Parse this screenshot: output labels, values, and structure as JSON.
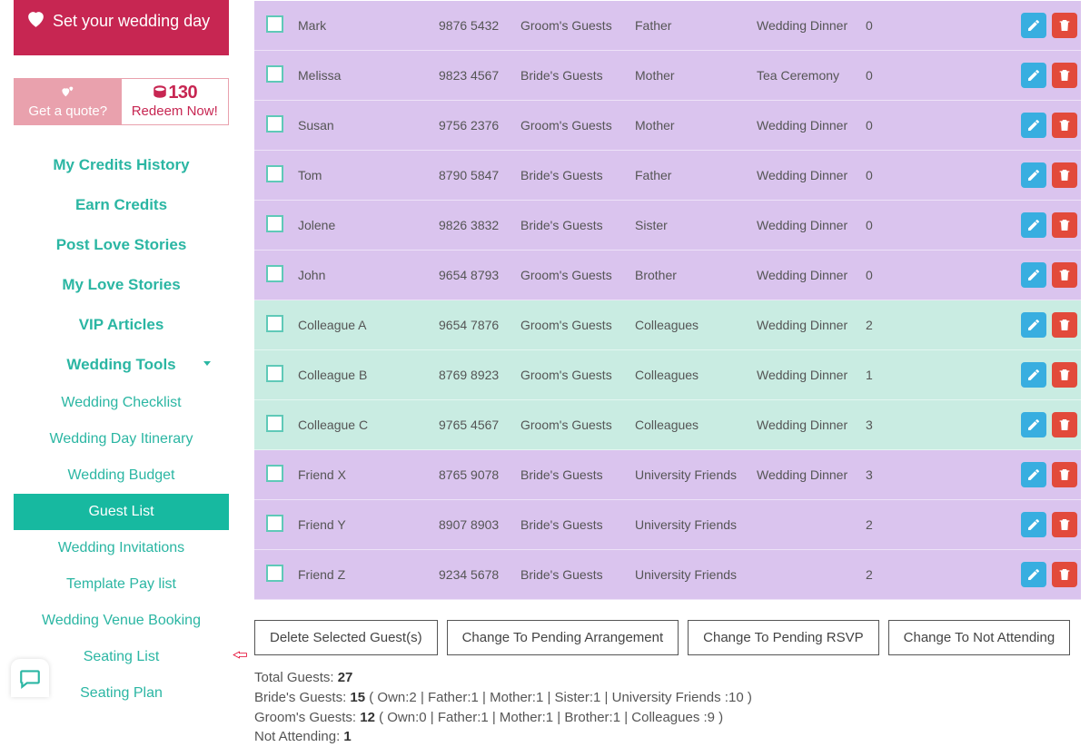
{
  "sidebar": {
    "set_day_label": "Set your wedding day",
    "quote_label": "Get a quote?",
    "credits_amount": "130",
    "redeem_label": "Redeem Now!",
    "nav_primary": [
      "My Credits History",
      "Earn Credits",
      "Post Love Stories",
      "My Love Stories",
      "VIP Articles",
      "Wedding Tools"
    ],
    "nav_sub": [
      "Wedding Checklist",
      "Wedding Day Itinerary",
      "Wedding Budget",
      "Guest List",
      "Wedding Invitations",
      "Template Pay list",
      "Wedding Venue Booking",
      "Seating List",
      "Seating Plan"
    ],
    "active_sub_index": 3,
    "arrow_sub_index": 7
  },
  "guests": [
    {
      "name": "Mark",
      "phone": "9876 5432",
      "group": "Groom's Guests",
      "relation": "Father",
      "event": "Wedding Dinner",
      "table": "0",
      "tone": "purple"
    },
    {
      "name": "Melissa",
      "phone": "9823 4567",
      "group": "Bride's Guests",
      "relation": "Mother",
      "event": "Tea Ceremony",
      "table": "0",
      "tone": "purple"
    },
    {
      "name": "Susan",
      "phone": "9756 2376",
      "group": "Groom's Guests",
      "relation": "Mother",
      "event": "Wedding Dinner",
      "table": "0",
      "tone": "purple"
    },
    {
      "name": "Tom",
      "phone": "8790 5847",
      "group": "Bride's Guests",
      "relation": "Father",
      "event": "Wedding Dinner",
      "table": "0",
      "tone": "purple"
    },
    {
      "name": "Jolene",
      "phone": "9826 3832",
      "group": "Bride's Guests",
      "relation": "Sister",
      "event": "Wedding Dinner",
      "table": "0",
      "tone": "purple"
    },
    {
      "name": "John",
      "phone": "9654 8793",
      "group": "Groom's Guests",
      "relation": "Brother",
      "event": "Wedding Dinner",
      "table": "0",
      "tone": "purple"
    },
    {
      "name": "Colleague A",
      "phone": "9654 7876",
      "group": "Groom's Guests",
      "relation": "Colleagues",
      "event": "Wedding Dinner",
      "table": "2",
      "tone": "teal"
    },
    {
      "name": "Colleague B",
      "phone": "8769 8923",
      "group": "Groom's Guests",
      "relation": "Colleagues",
      "event": "Wedding Dinner",
      "table": "1",
      "tone": "teal"
    },
    {
      "name": "Colleague C",
      "phone": "9765 4567",
      "group": "Groom's Guests",
      "relation": "Colleagues",
      "event": "Wedding Dinner",
      "table": "3",
      "tone": "teal"
    },
    {
      "name": "Friend X",
      "phone": "8765 9078",
      "group": "Bride's Guests",
      "relation": "University Friends",
      "event": "Wedding Dinner",
      "table": "3",
      "tone": "purple"
    },
    {
      "name": "Friend Y",
      "phone": "8907 8903",
      "group": "Bride's Guests",
      "relation": "University Friends",
      "event": "",
      "table": "2",
      "tone": "purple"
    },
    {
      "name": "Friend Z",
      "phone": "9234 5678",
      "group": "Bride's Guests",
      "relation": "University Friends",
      "event": "",
      "table": "2",
      "tone": "purple"
    }
  ],
  "bulk": {
    "delete": "Delete Selected Guest(s)",
    "pending_arr": "Change To Pending Arrangement",
    "pending_rsvp": "Change To Pending RSVP",
    "not_attending": "Change To Not Attending"
  },
  "stats": {
    "total_label": "Total Guests: ",
    "total_val": "27",
    "bride_line": "Bride's Guests: ",
    "bride_val": "15",
    "bride_detail": " ( Own:2 | Father:1 | Mother:1 | Sister:1 | University Friends :10 )",
    "groom_line": "Groom's Guests: ",
    "groom_val": "12",
    "groom_detail": " ( Own:0 | Father:1 | Mother:1 | Brother:1 | Colleagues :9 )",
    "na_label": "Not Attending: ",
    "na_val": "1"
  }
}
